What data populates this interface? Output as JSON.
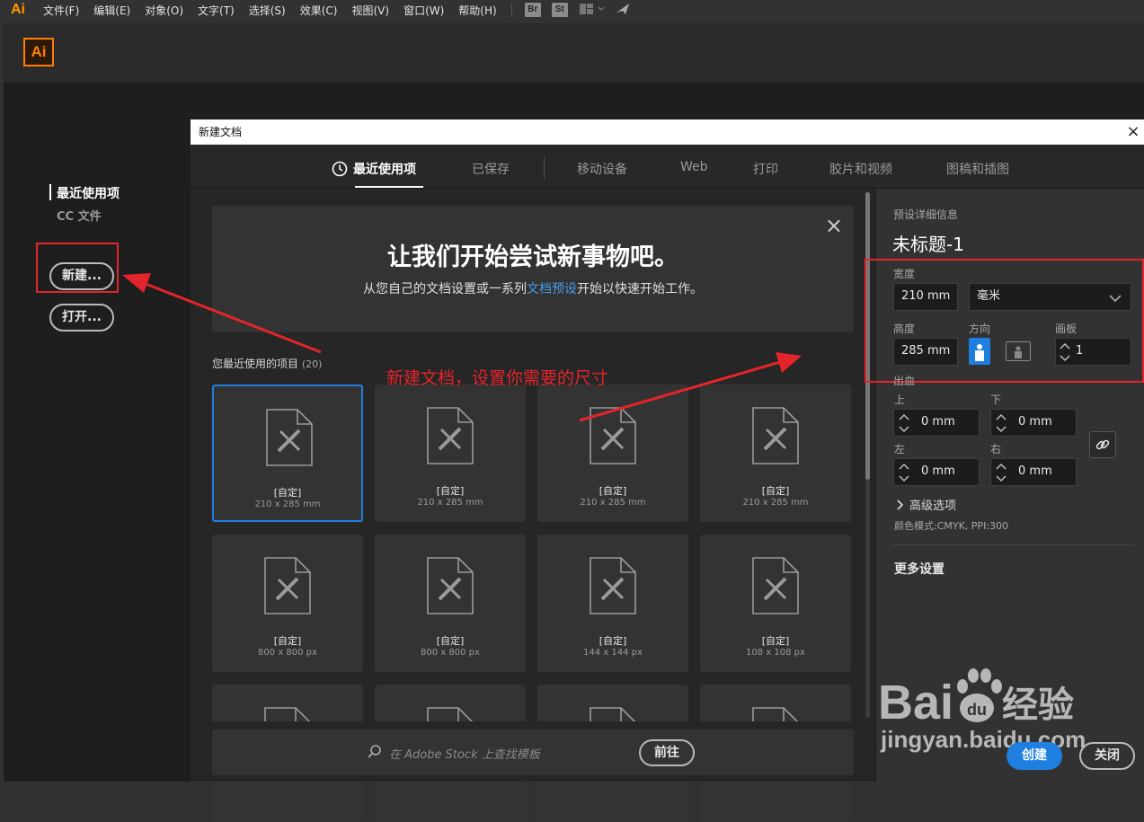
{
  "app": {
    "logo": "Ai",
    "badge_br": "Br",
    "badge_st": "St"
  },
  "menubar": [
    "文件(F)",
    "编辑(E)",
    "对象(O)",
    "文字(T)",
    "选择(S)",
    "效果(C)",
    "视图(V)",
    "窗口(W)",
    "帮助(H)"
  ],
  "start_screen": {
    "logo": "Ai",
    "nav": {
      "recent": "最近使用项",
      "cc_files": "CC 文件"
    },
    "new_button": "新建...",
    "open_button": "打开..."
  },
  "dialog": {
    "title": "新建文档",
    "close": "×",
    "tabs": [
      "最近使用项",
      "已保存",
      "移动设备",
      "Web",
      "打印",
      "胶片和视频",
      "图稿和插图"
    ],
    "welcome": {
      "title": "让我们开始尝试新事物吧。",
      "subtitle_before": "从您自己的文档设置或一系列",
      "subtitle_link": "文档预设",
      "subtitle_after": "开始以快速开始工作。",
      "close": "×"
    },
    "recent": {
      "label": "您最近使用的项目",
      "count": "(20)",
      "items": [
        {
          "name": "[自定]",
          "size": "210 x 285 mm"
        },
        {
          "name": "[自定]",
          "size": "210 x 285 mm"
        },
        {
          "name": "[自定]",
          "size": "210 x 285 mm"
        },
        {
          "name": "[自定]",
          "size": "210 x 285 mm"
        },
        {
          "name": "[自定]",
          "size": "800 x 800 px"
        },
        {
          "name": "[自定]",
          "size": "800 x 800 px"
        },
        {
          "name": "[自定]",
          "size": "144 x 144 px"
        },
        {
          "name": "[自定]",
          "size": "108 x 108 px"
        }
      ]
    },
    "search": {
      "placeholder": "在 Adobe Stock 上查找模板",
      "go": "前往"
    },
    "details": {
      "section_label": "预设详细信息",
      "preset_name": "未标题-1",
      "width_label": "宽度",
      "width_value": "210 mm",
      "unit": "毫米",
      "height_label": "高度",
      "height_value": "285 mm",
      "orientation_label": "方向",
      "artboards_label": "画板",
      "artboards_value": "1",
      "bleed_label": "出血",
      "bleed": {
        "top_label": "上",
        "top": "0 mm",
        "bottom_label": "下",
        "bottom": "0 mm",
        "left_label": "左",
        "left": "0 mm",
        "right_label": "右",
        "right": "0 mm"
      },
      "advanced": "高级选项",
      "color_mode": "颜色模式:CMYK, PPI:300",
      "more_settings": "更多设置"
    },
    "create_button": "创建",
    "close_button": "关闭"
  },
  "annotation": {
    "text": "新建文档，设置你需要的尺寸",
    "color": "#e3242b"
  },
  "watermark": {
    "brand_left": "Bai",
    "brand_right": "经验",
    "paw_text": "du",
    "url": "jingyan.baidu.com"
  },
  "colors": {
    "accent": "#1f7fe0",
    "annotation_red": "#e3242b",
    "ai_orange": "#ff7c00"
  }
}
